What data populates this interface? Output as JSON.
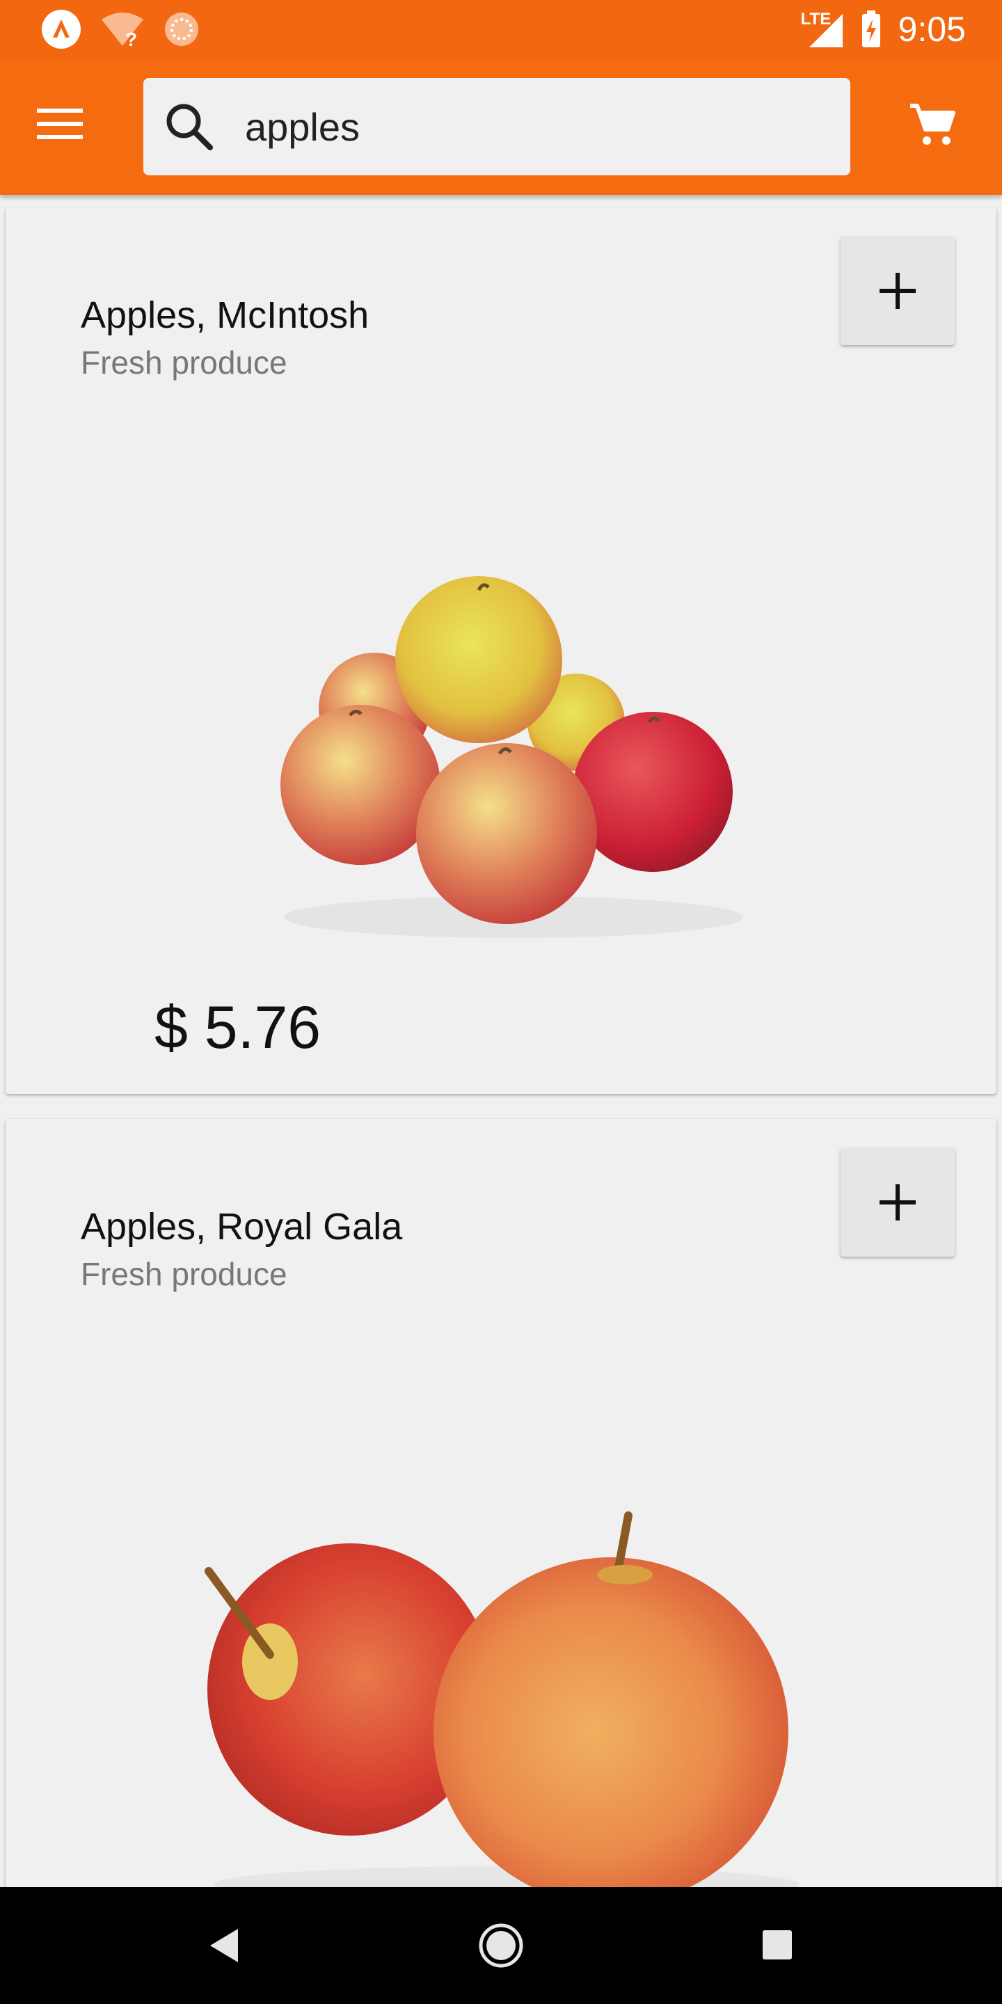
{
  "status_bar": {
    "time": "9:05",
    "network": "LTE",
    "icons": [
      "app-notification-icon",
      "wifi-unknown-icon",
      "sync-icon",
      "lte-signal-icon",
      "battery-charging-icon"
    ]
  },
  "app_bar": {
    "search": {
      "value": "apples",
      "placeholder": ""
    },
    "icons": [
      "menu-icon",
      "search-icon",
      "cart-icon"
    ]
  },
  "products": [
    {
      "name": "Apples, McIntosh",
      "category": "Fresh produce",
      "price": "$ 5.76",
      "add_label": "+"
    },
    {
      "name": "Apples, Royal Gala",
      "category": "Fresh produce",
      "add_label": "+"
    }
  ],
  "nav_bar": {
    "icons": [
      "back-icon",
      "home-icon",
      "recents-icon"
    ]
  },
  "colors": {
    "status_bar": "#f2670f",
    "app_bar": "#f46b10",
    "card_bg": "#f0f0f0",
    "subtitle": "#777777"
  }
}
